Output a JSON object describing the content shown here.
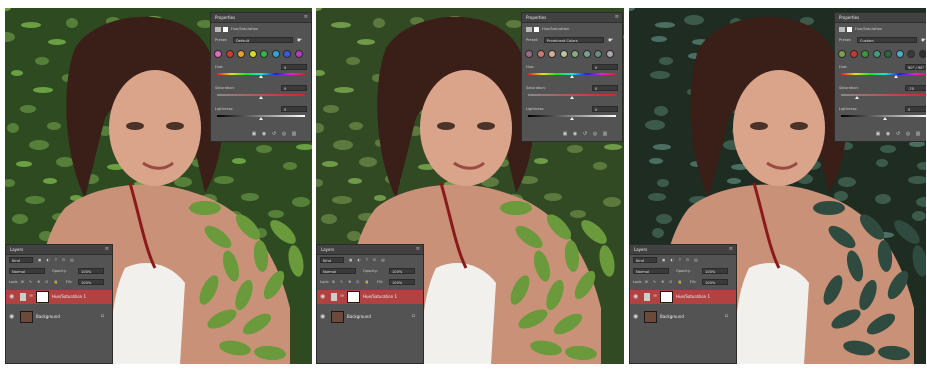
{
  "panels": [
    {
      "properties_title": "Properties",
      "adjustment_name": "Hue/Saturation",
      "preset_label": "Preset:",
      "preset_value": "Default",
      "sliders": [
        {
          "label": "Hue:",
          "value": "0"
        },
        {
          "label": "Saturation:",
          "value": "0"
        },
        {
          "label": "Lightness:",
          "value": "0"
        }
      ],
      "layers_title": "Layers",
      "kind_label": "Kind",
      "blend_mode": "Normal",
      "opacity_label": "Opacity:",
      "opacity_value": "100%",
      "lock_label": "Lock:",
      "fill_label": "Fill:",
      "fill_value": "100%",
      "layers": [
        {
          "name": "Hue/Saturation 1",
          "selected": true
        },
        {
          "name": "Background",
          "selected": false
        }
      ]
    },
    {
      "properties_title": "Properties",
      "adjustment_name": "Hue/Saturation",
      "preset_label": "Preset:",
      "preset_value": "Prominent Colors",
      "sliders": [
        {
          "label": "Hue:",
          "value": "0"
        },
        {
          "label": "Saturation:",
          "value": "0"
        },
        {
          "label": "Lightness:",
          "value": "0"
        }
      ],
      "layers_title": "Layers",
      "kind_label": "Kind",
      "blend_mode": "Normal",
      "opacity_label": "Opacity:",
      "opacity_value": "100%",
      "lock_label": "Lock:",
      "fill_label": "Fill:",
      "fill_value": "100%",
      "layers": [
        {
          "name": "Hue/Saturation 1",
          "selected": true
        },
        {
          "name": "Background",
          "selected": false
        }
      ]
    },
    {
      "properties_title": "Properties",
      "adjustment_name": "Hue/Saturation",
      "preset_label": "Preset:",
      "preset_value": "Custom",
      "sliders": [
        {
          "label": "Hue:",
          "value": "90° / 90°"
        },
        {
          "label": "Saturation:",
          "value": "-70"
        },
        {
          "label": "Lightness:",
          "value": "0"
        }
      ],
      "layers_title": "Layers",
      "kind_label": "Kind",
      "blend_mode": "Normal",
      "opacity_label": "Opacity:",
      "opacity_value": "100%",
      "lock_label": "Lock:",
      "fill_label": "Fill:",
      "fill_value": "100%",
      "layers": [
        {
          "name": "Hue/Saturation 1",
          "selected": true
        },
        {
          "name": "Background",
          "selected": false
        }
      ]
    }
  ],
  "swatch_colors": [
    [
      "#e06cc0",
      "#d23a2a",
      "#e8a02b",
      "#d6d82a",
      "#33b848",
      "#2fa6d6",
      "#3a58e0",
      "#b040c0"
    ],
    [
      "#9a6a80",
      "#c77a72",
      "#d4b090",
      "#b8c49a",
      "#84b07a",
      "#7aa096",
      "#6a8a86",
      "#b0a8b0"
    ],
    [
      "#7aa050",
      "#cc3a2a",
      "#3a9a3a",
      "#3ea07a",
      "#2a6a3a",
      "#4ab0c8",
      "#3a3a3a",
      "#303030"
    ]
  ],
  "colors": {
    "panel_bg": "#535353",
    "tab_bg": "#424242",
    "selected_layer_red": "#b24242"
  },
  "icons": [
    "eye-icon",
    "link-icon",
    "trash-icon",
    "mask-icon",
    "menu-icon",
    "hand-target-icon",
    "reset-icon",
    "visibility-icon"
  ]
}
